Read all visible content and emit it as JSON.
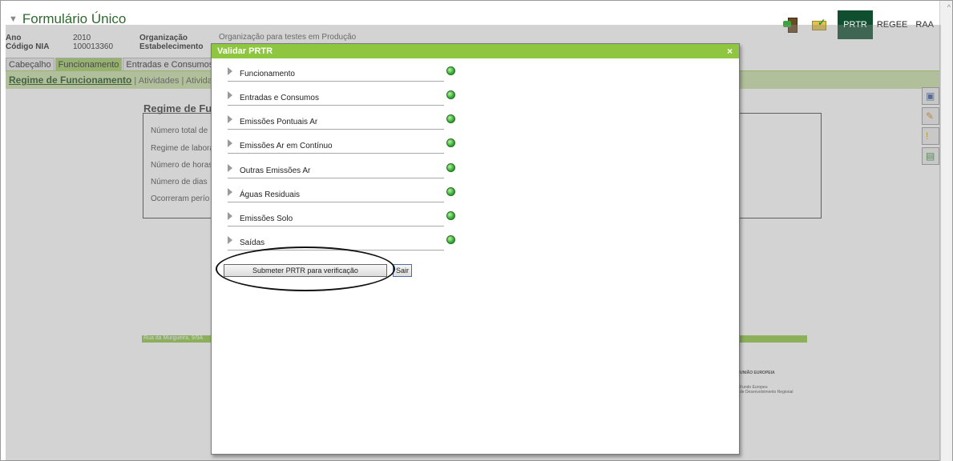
{
  "app": {
    "title": "Formulário Único"
  },
  "meta": {
    "ano_label": "Ano",
    "ano_value": "2010",
    "nia_label": "Código NIA",
    "nia_value": "100013360",
    "org_label": "Organização",
    "est_label": "Estabelecimento",
    "org_value": "Organização para testes em Produção"
  },
  "nav": {
    "prtr": "PRTR",
    "regee": "REGEE",
    "raa": "RAA"
  },
  "tabs": [
    "Cabeçalho",
    "Funcionamento",
    "Entradas e Consumos",
    ""
  ],
  "subnav": {
    "current": "Regime de Funcionamento",
    "sep": " | ",
    "item2": "Atividades",
    "item3": "Atividad"
  },
  "background": {
    "heading": "Regime de Fur",
    "rows": [
      "Número total de",
      "Regime de labora",
      "Número de horas",
      "Número de dias",
      "Ocorreram perío"
    ],
    "footer": "Rua da Murgueira, 9/9A",
    "eu_title": "UNIÃO EUROPEIA",
    "eu_sub1": "Fundo Europeu",
    "eu_sub2": "de Desenvolvimento Regional"
  },
  "modal": {
    "title": "Validar PRTR",
    "close": "×",
    "items": [
      {
        "label": "Funcionamento",
        "status": "ok"
      },
      {
        "label": "Entradas e Consumos",
        "status": "ok"
      },
      {
        "label": "Emissões Pontuais Ar",
        "status": "ok"
      },
      {
        "label": "Emissões Ar em Contínuo",
        "status": "ok"
      },
      {
        "label": "Outras Emissões Ar",
        "status": "ok"
      },
      {
        "label": "Águas Residuais",
        "status": "ok"
      },
      {
        "label": "Emissões Solo",
        "status": "ok"
      },
      {
        "label": "Saídas",
        "status": "ok"
      }
    ],
    "submit_label": "Submeter PRTR para verificação",
    "exit_label": "Sair"
  },
  "colors": {
    "accent": "#8ec63f",
    "nav_active": "#0f4f2f",
    "status_ok": "#3bb33b"
  }
}
